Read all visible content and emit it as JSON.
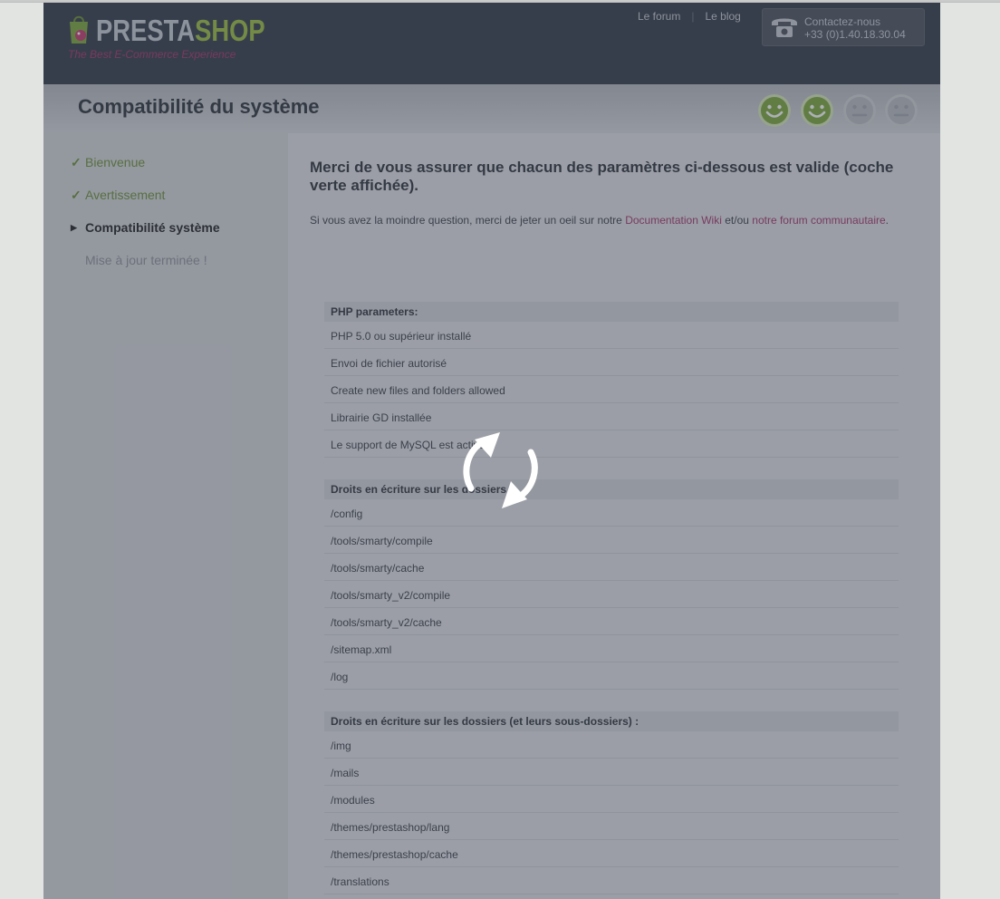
{
  "header": {
    "logo": {
      "word_a": "PRESTA",
      "word_b": "SHOP",
      "tagline": "The Best E-Commerce Experience"
    },
    "links": [
      "Le forum",
      "Le blog"
    ],
    "contact": {
      "icon": "phone-icon",
      "label": "Contactez-nous",
      "phone": "+33 (0)1.40.18.30.04"
    }
  },
  "titlebar": {
    "title": "Compatibilité du système",
    "progress_smileys": [
      "active",
      "active",
      "inactive",
      "inactive"
    ]
  },
  "sidebar": {
    "steps": [
      {
        "label": "Bienvenue",
        "state": "done"
      },
      {
        "label": "Avertissement",
        "state": "done"
      },
      {
        "label": "Compatibilité système",
        "state": "current"
      },
      {
        "label": "Mise à jour terminée !",
        "state": "todo"
      }
    ]
  },
  "main": {
    "heading": "Merci de vous assurer que chacun des paramètres ci-dessous est valide (coche verte affichée).",
    "intro_before": "Si vous avez la moindre question, merci de jeter un oeil sur notre ",
    "intro_link1": "Documentation Wiki",
    "intro_middle": " et/ou ",
    "intro_link2": "notre forum communautaire",
    "intro_after": "."
  },
  "sections": [
    {
      "title": "PHP parameters:",
      "rows": [
        "PHP 5.0 ou supérieur installé",
        "Envoi de fichier autorisé",
        "Create new files and folders allowed",
        "Librairie GD installée",
        "Le support de MySQL est activé"
      ]
    },
    {
      "title": "Droits en écriture sur les dossiers",
      "rows": [
        "/config",
        "/tools/smarty/compile",
        "/tools/smarty/cache",
        "/tools/smarty_v2/compile",
        "/tools/smarty_v2/cache",
        "/sitemap.xml",
        "/log"
      ]
    },
    {
      "title": "Droits en écriture sur les dossiers (et leurs sous-dossiers) :",
      "rows": [
        "/img",
        "/mails",
        "/modules",
        "/themes/prestashop/lang",
        "/themes/prestashop/cache",
        "/translations"
      ]
    }
  ],
  "colors": {
    "header_bg": "#353b47",
    "accent_green": "#9bbf3e",
    "link_pink": "#a3346a",
    "overlay_dim": "#4c5260"
  },
  "overlay": {
    "spinner_icon": "loading-spinner-icon"
  }
}
